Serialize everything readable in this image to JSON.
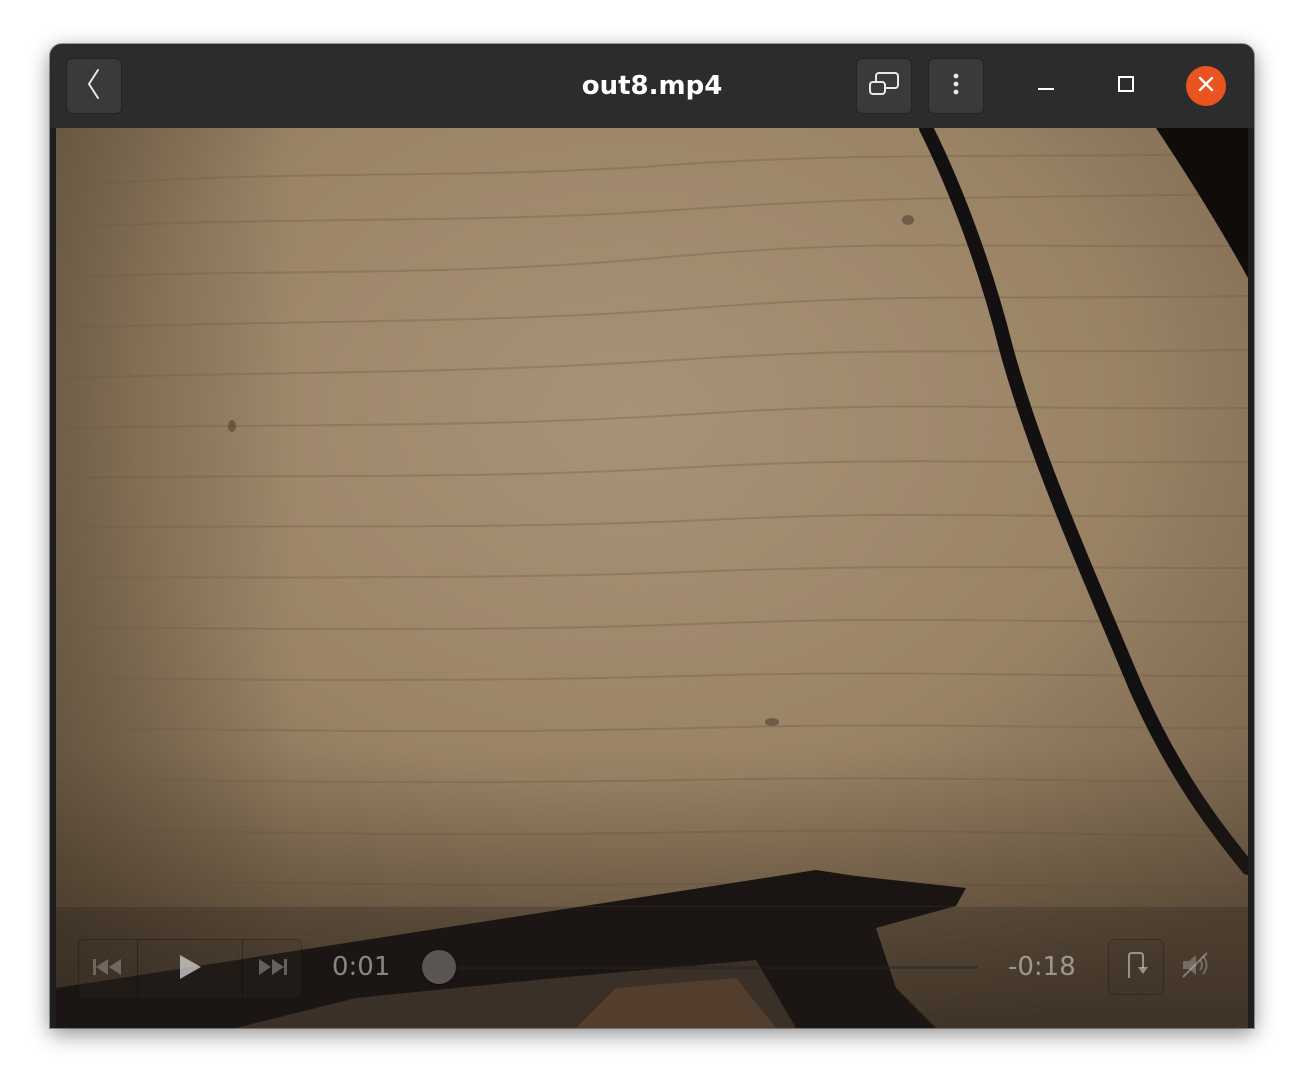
{
  "window": {
    "title": "out8.mp4"
  },
  "headerbar": {
    "back_icon": "chevron-left-icon",
    "pip_icon": "picture-in-picture-icon",
    "menu_icon": "vertical-dots-icon",
    "minimize_icon": "minimize-icon",
    "maximize_icon": "maximize-icon",
    "close_icon": "close-icon",
    "close_color": "#e95420"
  },
  "video": {
    "content": "wood-table-with-cable",
    "dominant_color": "#a18a6a"
  },
  "controls": {
    "elapsed": "0:01",
    "remaining": "-0:18",
    "progress_fraction": 0.03,
    "prev_icon": "skip-back-icon",
    "play_icon": "play-icon",
    "next_icon": "skip-forward-icon",
    "rotate_icon": "rotate-icon",
    "volume_icon": "volume-muted-icon"
  }
}
